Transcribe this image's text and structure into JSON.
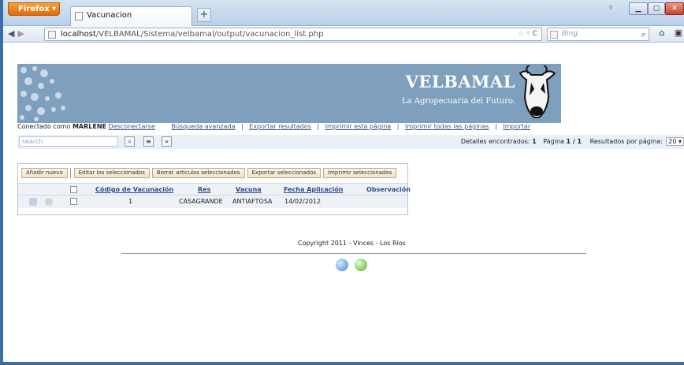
{
  "browser": {
    "app_button": "Firefox",
    "tab_title": "Vacunacion",
    "new_tab": "+",
    "url_host": "localhost",
    "url_path": "/VELBAMAL/Sistema/velbamal/output/vacunacion_list.php",
    "search_engine": "Bing"
  },
  "header": {
    "brand": "VELBAMAL",
    "tagline": "La Agropecuaria del Futuro."
  },
  "userbar": {
    "prefix": "Conectado como",
    "user": "MARLENE",
    "logout": "Desconectarse",
    "links": [
      "Búsqueda avanzada",
      "Exportar resultados",
      "Imprimir esta página",
      "Imprimir todas las páginas",
      "Importar"
    ]
  },
  "search": {
    "placeholder": "search",
    "details_label": "Detalles encontrados:",
    "details_count": "1",
    "page_label": "Página",
    "page_value": "1 / 1",
    "per_page_label": "Resultados por página:",
    "per_page_value": "20"
  },
  "actions": {
    "add": "Añadir nuevo",
    "edit": "Editar los seleccionados",
    "delete": "Borrar articulos seleccionados",
    "export": "Exportar seleccionados",
    "print": "Imprimir seleccionados"
  },
  "table": {
    "columns": [
      "Código de Vacunación",
      "Res",
      "Vacuna",
      "Fecha Aplicación",
      "Observación"
    ],
    "rows": [
      {
        "codigo": "1",
        "res": "CASAGRANDE",
        "vacuna": "ANTIAFTOSA",
        "fecha": "14/02/2012",
        "observacion": ""
      }
    ]
  },
  "footer": {
    "copyright": "Copyright 2011 - Vinces - Los Ríos"
  },
  "colors": {
    "banner": "#7f9fbe",
    "link": "#3a5a90",
    "firefox_orange": "#e06a0c"
  }
}
